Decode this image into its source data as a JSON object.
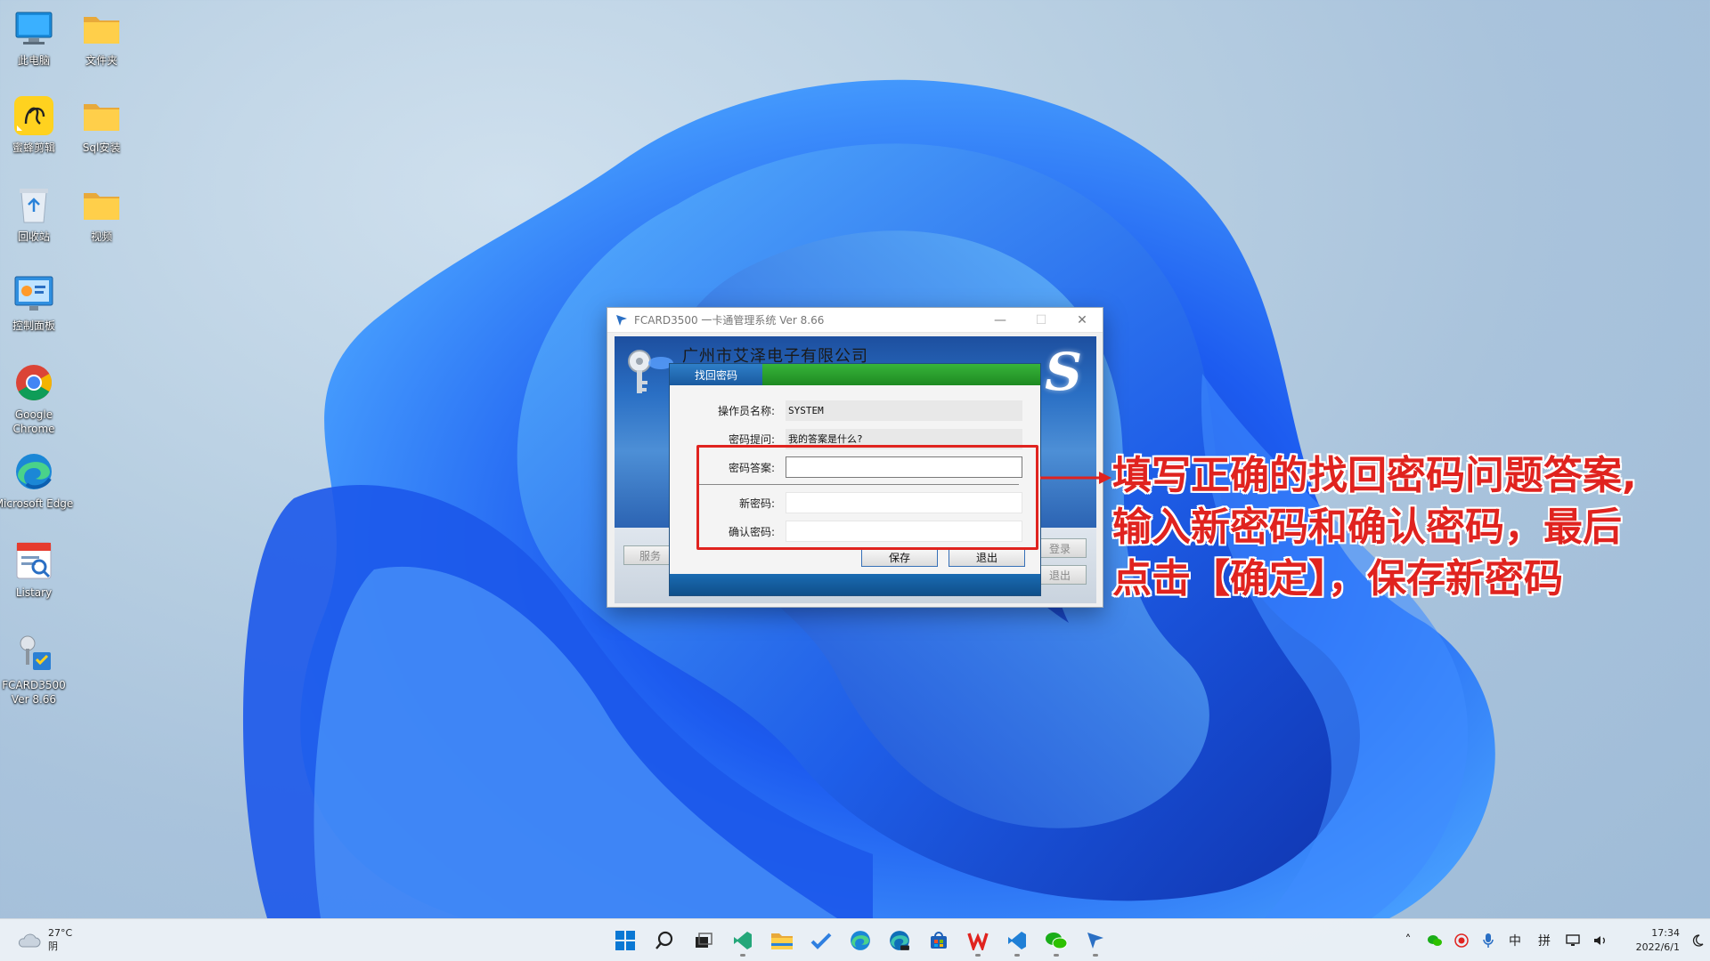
{
  "desktop_icons": [
    {
      "label": "此电脑",
      "icon": "monitor-icon"
    },
    {
      "label": "文件夹",
      "icon": "folder-icon"
    },
    {
      "label": "蜜蜂剪辑",
      "icon": "bee-video-icon"
    },
    {
      "label": "Sql安装",
      "icon": "folder-icon"
    },
    {
      "label": "回收站",
      "icon": "recycle-bin-icon"
    },
    {
      "label": "视频",
      "icon": "folder-icon"
    },
    {
      "label": "控制面板",
      "icon": "control-panel-icon"
    },
    {
      "label": "Google Chrome",
      "icon": "chrome-icon"
    },
    {
      "label": "Microsoft Edge",
      "icon": "edge-icon"
    },
    {
      "label": "Listary",
      "icon": "listary-icon"
    },
    {
      "label": "FCARD3500 Ver 8.66",
      "icon": "fcard-icon"
    }
  ],
  "window": {
    "title": "FCARD3500 一卡通管理系统  Ver 8.66",
    "company": "广州市艾泽电子有限公司",
    "logo_letter": "S",
    "side_buttons": {
      "service": "服务",
      "login": "登录",
      "exit": "退出"
    }
  },
  "dialog": {
    "tab_label": "找回密码",
    "fields": {
      "operator_label": "操作员名称:",
      "operator_value": "SYSTEM",
      "hint_label": "密码提问:",
      "hint_value": "我的答案是什么?",
      "answer_label": "密码答案:",
      "new_pwd_label": "新密码:",
      "confirm_pwd_label": "确认密码:"
    },
    "buttons": {
      "save": "保存",
      "exit": "退出"
    }
  },
  "annotation": {
    "line1": "填写正确的找回密码问题答案,",
    "line2": "输入新密码和确认密码，最后",
    "line3": "点击【确定】，保存新密码",
    "color": "#e0231f"
  },
  "taskbar": {
    "weather_temp": "27°C",
    "weather_desc": "阴",
    "ime_lang": "中",
    "ime_mode": "拼",
    "time": "17:34",
    "date": "2022/6/1"
  },
  "colors": {
    "dialog_header": "#1e8a22",
    "dialog_tab": "#1a5aa0",
    "accent": "#2a6fc4"
  }
}
